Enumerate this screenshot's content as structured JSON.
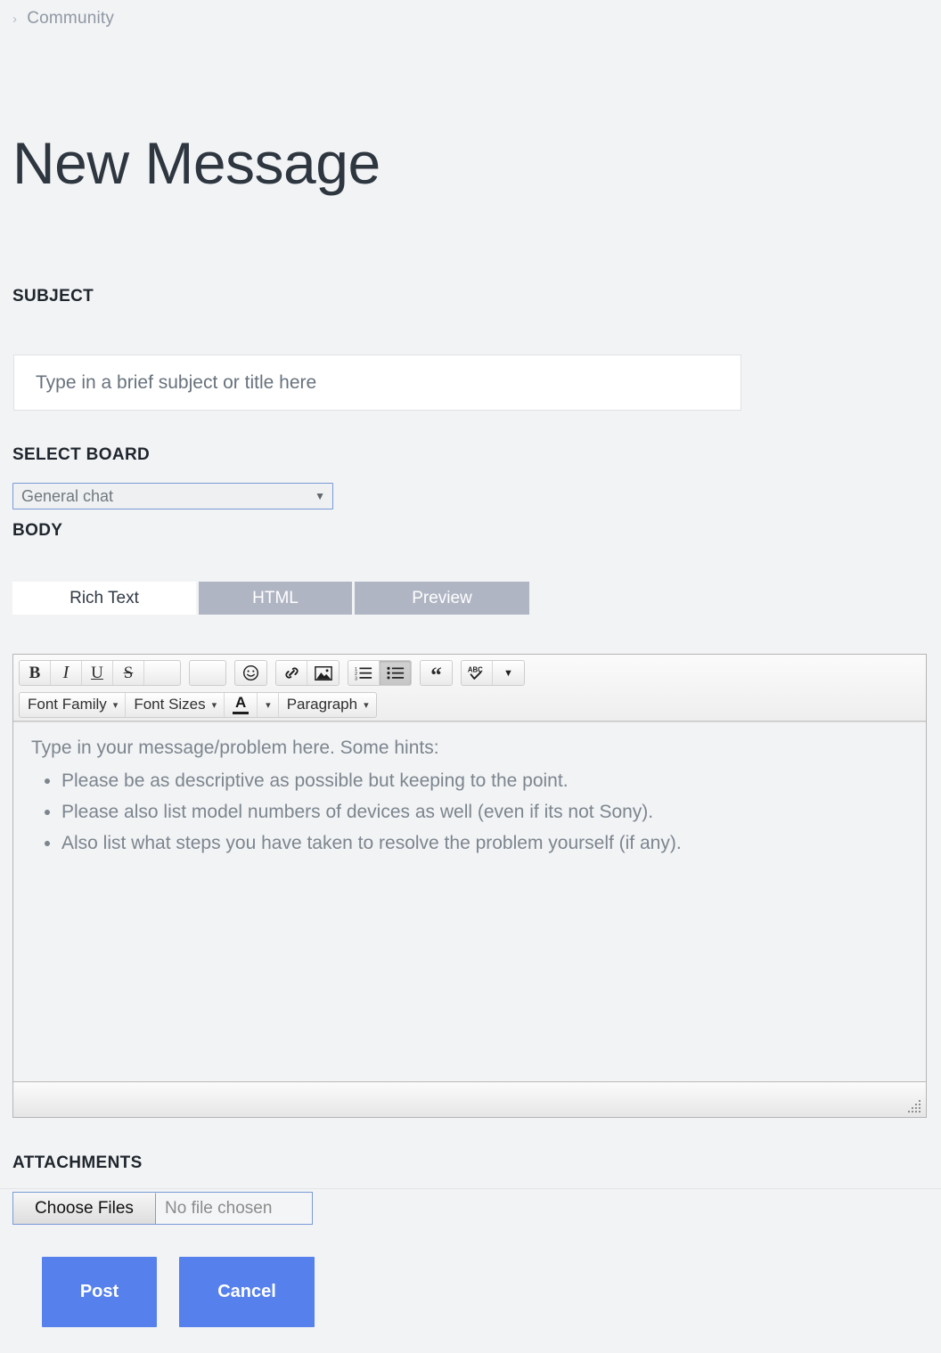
{
  "breadcrumb": {
    "separator": "›",
    "items": [
      "Community"
    ]
  },
  "page_title": "New Message",
  "form": {
    "subject": {
      "label": "SUBJECT",
      "placeholder": "Type in a brief subject or title here",
      "value": ""
    },
    "board": {
      "label": "SELECT BOARD",
      "selected": "General chat",
      "options": [
        "General chat"
      ],
      "caret": "▼"
    },
    "body": {
      "label": "BODY",
      "tabs": [
        {
          "label": "Rich Text",
          "active": true
        },
        {
          "label": "HTML",
          "active": false
        },
        {
          "label": "Preview",
          "active": false
        }
      ],
      "toolbar": {
        "row1": [
          {
            "name": "bold-icon",
            "glyph": "B"
          },
          {
            "name": "italic-icon",
            "glyph": "I"
          },
          {
            "name": "underline-icon",
            "glyph": "U"
          },
          {
            "name": "strikethrough-icon",
            "glyph": "S"
          },
          {
            "name": "blank-icon",
            "glyph": ""
          },
          {
            "name": "spacer-icon",
            "glyph": ""
          },
          {
            "name": "emoji-icon",
            "glyph": "☺"
          },
          {
            "name": "link-icon",
            "glyph": "🔗"
          },
          {
            "name": "image-icon",
            "glyph": "🖼"
          },
          {
            "name": "numbered-list-icon",
            "glyph": ""
          },
          {
            "name": "bullet-list-icon",
            "glyph": ""
          },
          {
            "name": "blockquote-icon",
            "glyph": "“"
          },
          {
            "name": "spellcheck-icon",
            "glyph": "ABC"
          }
        ],
        "row2": [
          {
            "name": "font-family-dropdown",
            "label": "Font Family",
            "caret": "▾"
          },
          {
            "name": "font-sizes-dropdown",
            "label": "Font Sizes",
            "caret": "▾"
          },
          {
            "name": "text-color-picker",
            "label": "A",
            "caret": "▾"
          },
          {
            "name": "paragraph-dropdown",
            "label": "Paragraph",
            "caret": "▾"
          }
        ]
      },
      "placeholder_intro": "Type in your message/problem here.  Some hints:",
      "placeholder_hints": [
        "Please be as descriptive as possible but keeping to the point.",
        "Please also list model numbers of devices as well (even if its not Sony).",
        "Also list what steps you have taken to resolve the problem yourself (if any)."
      ]
    },
    "attachments": {
      "label": "ATTACHMENTS",
      "choose_files_label": "Choose Files",
      "file_status": "No file chosen"
    },
    "actions": {
      "post_label": "Post",
      "cancel_label": "Cancel"
    }
  },
  "colors": {
    "page_background": "#f2f3f5",
    "title_text": "#2e3640",
    "accent_button": "#5681ec",
    "tab_inactive": "#b0b5c4",
    "focus_border": "#7a9bd6",
    "placeholder_text": "#7c858e"
  }
}
